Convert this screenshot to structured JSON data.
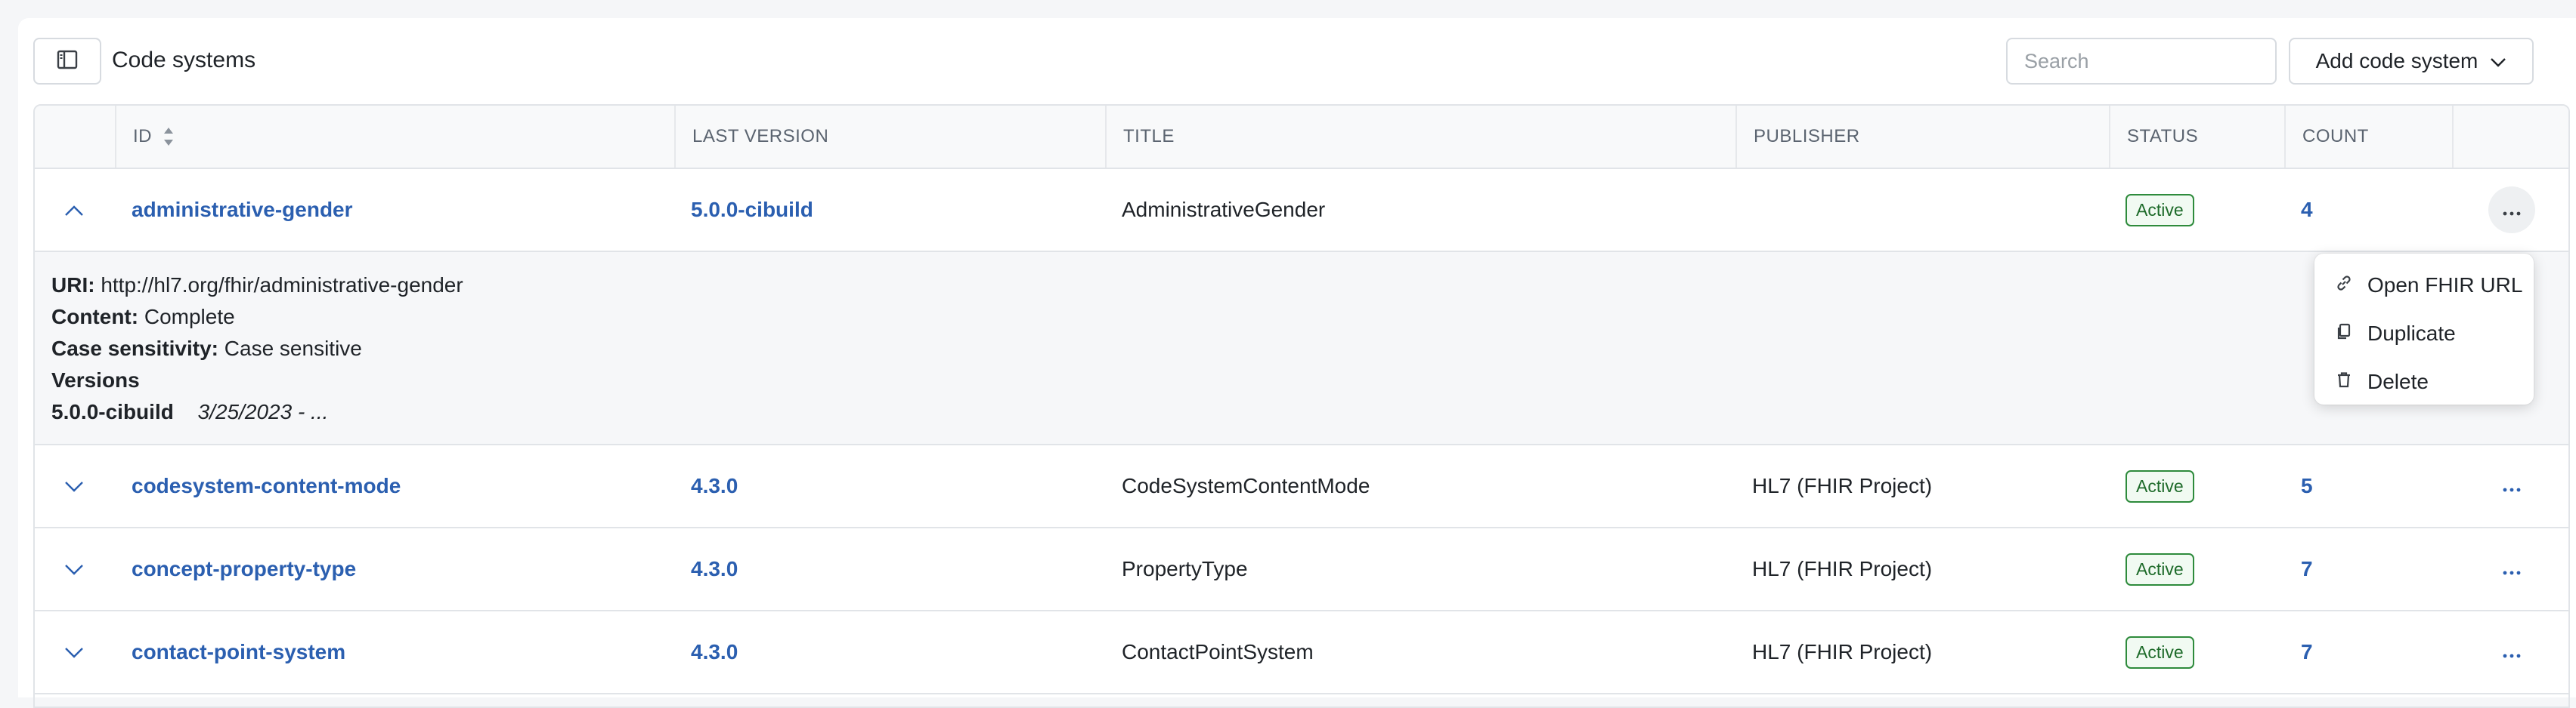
{
  "toolbar": {
    "title": "Code systems",
    "search_placeholder": "Search",
    "add_label": "Add code system"
  },
  "columns": [
    "ID",
    "LAST VERSION",
    "TITLE",
    "PUBLISHER",
    "STATUS",
    "COUNT"
  ],
  "rows": [
    {
      "id": "administrative-gender",
      "version": "5.0.0-cibuild",
      "title": "AdministrativeGender",
      "publisher": "",
      "status": "Active",
      "count": "4",
      "expanded": true
    },
    {
      "id": "codesystem-content-mode",
      "version": "4.3.0",
      "title": "CodeSystemContentMode",
      "publisher": "HL7 (FHIR Project)",
      "status": "Active",
      "count": "5",
      "expanded": false
    },
    {
      "id": "concept-property-type",
      "version": "4.3.0",
      "title": "PropertyType",
      "publisher": "HL7 (FHIR Project)",
      "status": "Active",
      "count": "7",
      "expanded": false
    },
    {
      "id": "contact-point-system",
      "version": "4.3.0",
      "title": "ContactPointSystem",
      "publisher": "HL7 (FHIR Project)",
      "status": "Active",
      "count": "7",
      "expanded": false
    }
  ],
  "detail": {
    "uri_label": "URI:",
    "uri": "http://hl7.org/fhir/administrative-gender",
    "content_label": "Content:",
    "content": "Complete",
    "case_label": "Case sensitivity:",
    "case": "Case sensitive",
    "versions_label": "Versions",
    "version_name": "5.0.0-cibuild",
    "version_date": "3/25/2023 - ..."
  },
  "menu": {
    "open": "Open FHIR URL",
    "duplicate": "Duplicate",
    "delete": "Delete"
  },
  "colors": {
    "link": "#2b5fb0",
    "badge_border": "#2e8b3c",
    "badge_text": "#1e6b2a"
  }
}
